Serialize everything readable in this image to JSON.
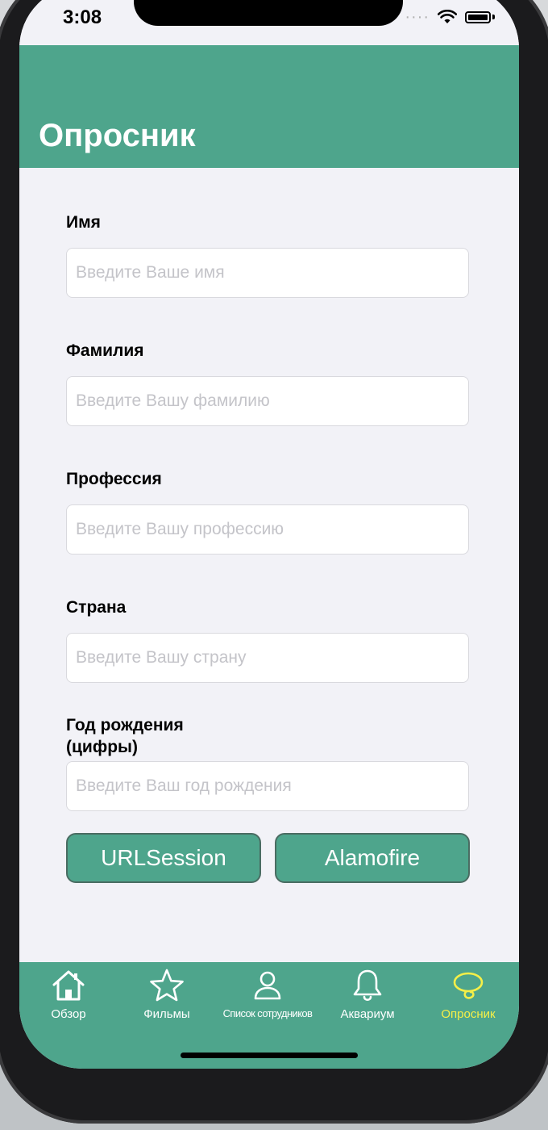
{
  "status_bar": {
    "time": "3:08",
    "signal_icon": "cellular-dots-icon",
    "wifi_icon": "wifi-icon",
    "battery_icon": "battery-icon"
  },
  "nav": {
    "title": "Опросник"
  },
  "form": {
    "fields": [
      {
        "label": "Имя",
        "placeholder": "Введите Ваше имя",
        "value": ""
      },
      {
        "label": "Фамилия",
        "placeholder": "Введите Вашу фамилию",
        "value": ""
      },
      {
        "label": "Профессия",
        "placeholder": "Введите Вашу профессию",
        "value": ""
      },
      {
        "label": "Страна",
        "placeholder": "Введите Вашу страну",
        "value": ""
      },
      {
        "label_line1": "Год рождения",
        "label_line2": "(цифры)",
        "placeholder": "Введите Ваш год рождения",
        "value": ""
      }
    ],
    "buttons": {
      "urlsession": "URLSession",
      "alamofire": "Alamofire"
    }
  },
  "tab_bar": {
    "tabs": [
      {
        "label": "Обзор",
        "icon": "house-icon"
      },
      {
        "label": "Фильмы",
        "icon": "star-icon"
      },
      {
        "label": "Список сотрудников",
        "icon": "person-icon"
      },
      {
        "label": "Аквариум",
        "icon": "bell-icon"
      },
      {
        "label": "Опросник",
        "icon": "lasso-icon",
        "active": true
      }
    ]
  },
  "colors": {
    "accent": "#4ea58c",
    "active_tab": "#f5ef48",
    "background": "#f2f2f7"
  }
}
